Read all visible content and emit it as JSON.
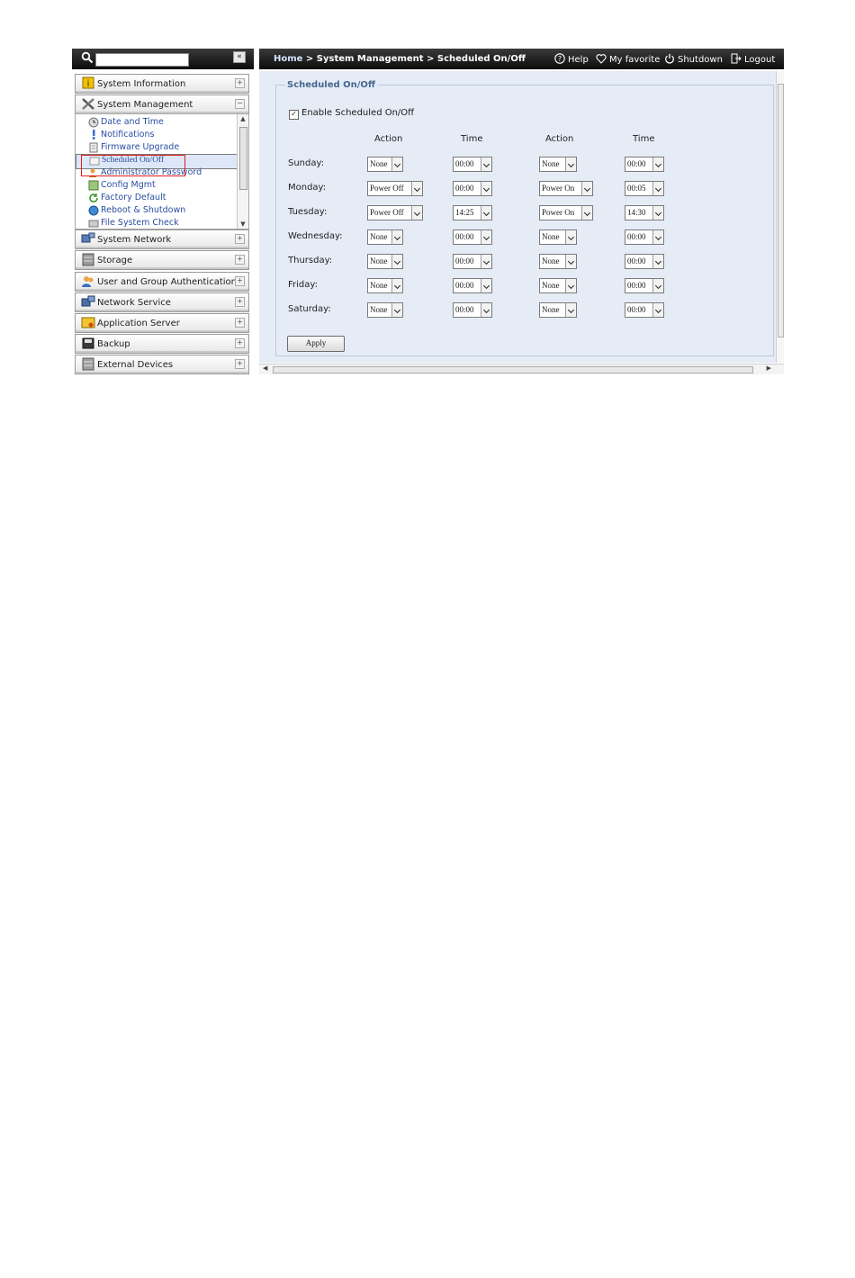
{
  "search": {
    "placeholder": "",
    "collapse_label": "«"
  },
  "sidebar": {
    "categories": [
      {
        "label": "System Information"
      },
      {
        "label": "System Management"
      },
      {
        "label": "System Network"
      },
      {
        "label": "Storage"
      },
      {
        "label": "User and Group Authentication"
      },
      {
        "label": "Network Service"
      },
      {
        "label": "Application Server"
      },
      {
        "label": "Backup"
      },
      {
        "label": "External Devices"
      }
    ],
    "submenu": [
      {
        "label": "Date and Time"
      },
      {
        "label": "Notifications"
      },
      {
        "label": "Firmware Upgrade"
      },
      {
        "label": "Scheduled On/Off"
      },
      {
        "label": "Administrator Password"
      },
      {
        "label": "Config Mgmt"
      },
      {
        "label": "Factory Default"
      },
      {
        "label": "Reboot & Shutdown"
      },
      {
        "label": "File System Check"
      }
    ],
    "selected_submenu": "Scheduled On/Off"
  },
  "header": {
    "breadcrumb_home": "Home",
    "breadcrumb_rest": " > System Management > Scheduled On/Off",
    "help": "Help",
    "favorite": "My favorite",
    "shutdown": "Shutdown",
    "logout": "Logout"
  },
  "form": {
    "title": "Scheduled On/Off",
    "enable_label": "Enable Scheduled On/Off",
    "enable_checked": true,
    "checkmark": "✓",
    "columns": {
      "action1": "Action",
      "time1": "Time",
      "action2": "Action",
      "time2": "Time"
    },
    "rows": [
      {
        "day": "Sunday:",
        "action1": "None",
        "time1": "00:00",
        "action2": "None",
        "time2": "00:00"
      },
      {
        "day": "Monday:",
        "action1": "Power Off",
        "time1": "00:00",
        "action2": "Power On",
        "time2": "00:05"
      },
      {
        "day": "Tuesday:",
        "action1": "Power Off",
        "time1": "14:25",
        "action2": "Power On",
        "time2": "14:30"
      },
      {
        "day": "Wednesday:",
        "action1": "None",
        "time1": "00:00",
        "action2": "None",
        "time2": "00:00"
      },
      {
        "day": "Thursday:",
        "action1": "None",
        "time1": "00:00",
        "action2": "None",
        "time2": "00:00"
      },
      {
        "day": "Friday:",
        "action1": "None",
        "time1": "00:00",
        "action2": "None",
        "time2": "00:00"
      },
      {
        "day": "Saturday:",
        "action1": "None",
        "time1": "00:00",
        "action2": "None",
        "time2": "00:00"
      }
    ],
    "apply_label": "Apply"
  },
  "colors": {
    "highlight": "#e21d1d",
    "panel": "#e6ecf6",
    "legend": "#45668f",
    "link": "#2a4da0"
  }
}
